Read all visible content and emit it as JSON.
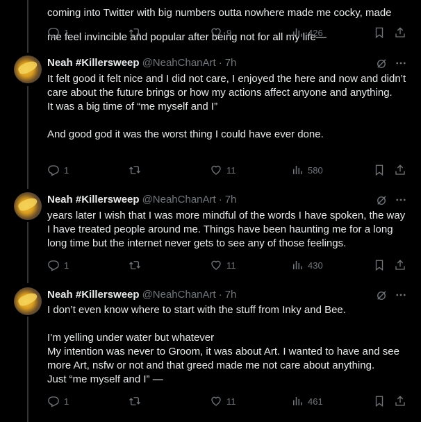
{
  "top_tweet": {
    "lines": [
      "coming into Twitter with big numbers outta nowhere made me cocky, made",
      "me feel invincible and popular after being not for all my life—"
    ],
    "replies": "1",
    "likes": "9",
    "views": "426"
  },
  "tweets": [
    {
      "name": "Neah #Killersweep",
      "handle": "@NeahChanArt",
      "dot": "·",
      "time": "7h",
      "paragraphs": [
        "It felt good it felt nice and I did not care, I enjoyed the here and now and didn’t care about the future brings or how my actions affect anyone and anything.",
        "It was a big time of “me myself and I”",
        "",
        "And good god it was the worst thing I could have ever done."
      ],
      "replies": "1",
      "likes": "11",
      "views": "580"
    },
    {
      "name": "Neah #Killersweep",
      "handle": "@NeahChanArt",
      "dot": "·",
      "time": "7h",
      "paragraphs": [
        "years later I wish that I was more mindful of the words I have spoken, the way I have treated people around me. Things have been haunting me for a long long time but the internet never gets to see any of those feelings."
      ],
      "replies": "1",
      "likes": "11",
      "views": "430"
    },
    {
      "name": "Neah #Killersweep",
      "handle": "@NeahChanArt",
      "dot": "·",
      "time": "7h",
      "paragraphs": [
        "I don’t even know where to start with the stuff from Inky and Bee.",
        "",
        "I’m yelling under water but whatever",
        "My intention was never to Groom, it was about Art. I wanted to have and see more Art, nsfw or not and that greed made me not care about anything.",
        "Just “me myself and I” —"
      ],
      "replies": "1",
      "likes": "11",
      "views": "461"
    }
  ],
  "icons": [
    "reply-icon",
    "retweet-icon",
    "like-icon",
    "views-icon",
    "bookmark-icon",
    "share-icon",
    "grok-icon",
    "more-icon"
  ],
  "colors": {
    "background": "#000000",
    "text": "#e7e9ea",
    "muted": "#71767b",
    "divider": "#2f3336"
  }
}
